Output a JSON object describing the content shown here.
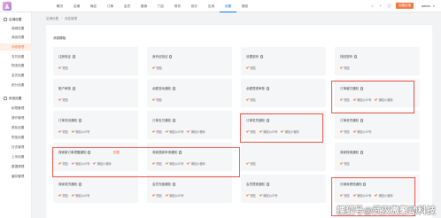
{
  "header": {
    "nav": [
      {
        "label": "概况",
        "active": false
      },
      {
        "label": "店铺",
        "active": false
      },
      {
        "label": "商品",
        "active": false
      },
      {
        "label": "订单",
        "active": false
      },
      {
        "label": "会员",
        "active": false
      },
      {
        "label": "营销",
        "active": false
      },
      {
        "label": "门店",
        "active": false
      },
      {
        "label": "财务",
        "active": false
      },
      {
        "label": "统计",
        "active": false
      },
      {
        "label": "应用",
        "active": false
      },
      {
        "label": "设置",
        "active": true
      },
      {
        "label": "授权",
        "active": false
      }
    ],
    "create_button": "创建店铺",
    "user": "admin"
  },
  "sidebar": [
    {
      "label": "店铺设置",
      "group": true
    },
    {
      "label": "商城设置"
    },
    {
      "label": "商品设置"
    },
    {
      "label": "消息管理",
      "active": true
    },
    {
      "label": "支付设置"
    },
    {
      "label": "物流设置"
    },
    {
      "label": "会员设置"
    },
    {
      "label": "积分设置"
    },
    {
      "label": "系统设置",
      "group": true
    },
    {
      "label": "权限管理"
    },
    {
      "label": "操作管理"
    },
    {
      "label": "角色设置"
    },
    {
      "label": "短信设置"
    },
    {
      "label": "日志管理"
    },
    {
      "label": "上传设置"
    },
    {
      "label": "数据清理"
    },
    {
      "label": "缓存管理"
    }
  ],
  "breadcrumb": [
    "店铺设置",
    "消息管理"
  ],
  "section_title": "消息模板",
  "cards": [
    {
      "title": "注册验证",
      "options": [
        "短信"
      ]
    },
    {
      "title": "身份证验证",
      "options": [
        "短信"
      ]
    },
    {
      "title": "设置密码",
      "options": [
        "短信"
      ]
    },
    {
      "title": "找回密码",
      "options": [
        "短信"
      ]
    },
    {
      "title": "账户审核",
      "options": [
        "短信"
      ]
    },
    {
      "title": "余额变动通知",
      "options": [
        "短信"
      ]
    },
    {
      "title": "余额提现审核",
      "options": [
        "短信"
      ]
    },
    {
      "title": "订单催付通知",
      "options": [
        "短信",
        "微信公众号",
        "微信小程序"
      ]
    },
    {
      "title": "订单关闭通知",
      "options": [
        "短信",
        "微信公众号"
      ]
    },
    {
      "title": "订单支付通知",
      "options": [
        "短信",
        "微信公众号",
        "微信小程序"
      ]
    },
    {
      "title": "订单发货通知",
      "options": [
        "短信",
        "微信公众号",
        "微信小程序"
      ]
    },
    {
      "title": "订单收货通知",
      "options": [
        "短信",
        "微信公众号"
      ]
    },
    {
      "title": "商家新订单提醒通知",
      "options": [
        "短信",
        "微信公众号",
        "微信小程序"
      ],
      "link": "配置"
    },
    {
      "title": "商家退款申请通知",
      "options": [
        "短信",
        "微信公众号",
        "微信小程序"
      ]
    },
    {
      "title": "",
      "options": [
        "短信"
      ]
    },
    {
      "title": "商家核销通知",
      "options": [
        "短信"
      ]
    },
    {
      "title": "商家收货通知",
      "options": [
        "短信",
        "微信公众号"
      ]
    },
    {
      "title": "会员充值通知",
      "options": [
        "短信",
        "微信公众号"
      ]
    },
    {
      "title": "会员提现通知",
      "options": [
        "短信",
        "微信公众号"
      ]
    },
    {
      "title": "分销商提现通知",
      "options": [
        "短信",
        "微信公众号",
        "微信小程序"
      ]
    }
  ],
  "watermark": "搜狐号@武汉微聚动科技"
}
